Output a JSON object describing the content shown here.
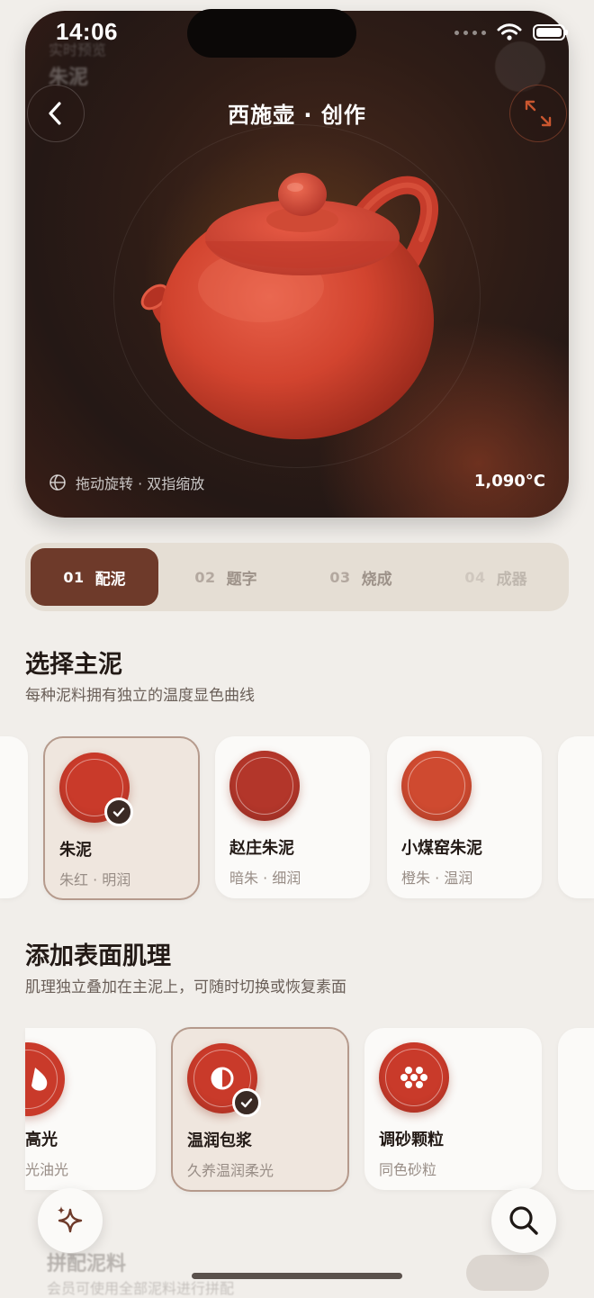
{
  "status": {
    "time": "14:06"
  },
  "hero": {
    "faded_label": "实时预览",
    "faded_name": "朱泥",
    "title": "西施壶 · 创作",
    "hint": "拖动旋转 · 双指缩放",
    "temperature": "1,090°C",
    "clay_color": "#d64a36"
  },
  "steps": [
    {
      "num": "01",
      "label": "配泥",
      "state": "active"
    },
    {
      "num": "02",
      "label": "题字",
      "state": "idle"
    },
    {
      "num": "03",
      "label": "烧成",
      "state": "idle"
    },
    {
      "num": "04",
      "label": "成器",
      "state": "disabled"
    }
  ],
  "clay_section": {
    "title": "选择主泥",
    "subtitle": "每种泥料拥有独立的温度显色曲线",
    "items": [
      {
        "name": "朱泥",
        "desc": "朱红 · 明润",
        "color": "#c93a2a",
        "selected": true
      },
      {
        "name": "赵庄朱泥",
        "desc": "暗朱 · 细润",
        "color": "#b3362a",
        "selected": false
      },
      {
        "name": "小煤窑朱泥",
        "desc": "橙朱 · 温润",
        "color": "#cf4a30",
        "selected": false
      }
    ]
  },
  "texture_section": {
    "title": "添加表面肌理",
    "subtitle": "肌理独立叠加在主泥上，可随时切换或恢复素面",
    "items": [
      {
        "name": "高光",
        "desc": "光油光",
        "icon": "droplet-icon",
        "selected": false
      },
      {
        "name": "温润包浆",
        "desc": "久养温润柔光",
        "icon": "half-circle-icon",
        "selected": true
      },
      {
        "name": "调砂颗粒",
        "desc": "同色砂粒",
        "icon": "grains-icon",
        "selected": false
      }
    ]
  },
  "bottom": {
    "faded_title": "拼配泥料",
    "faded_sub": "会员可使用全部泥料进行拼配"
  },
  "colors": {
    "accent": "#6e3a2a",
    "clay": "#c93a2a",
    "background": "#f1eeea"
  }
}
